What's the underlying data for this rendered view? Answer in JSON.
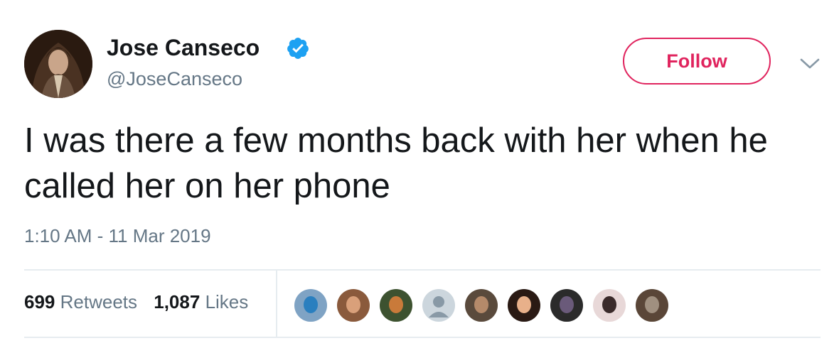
{
  "author": {
    "name": "Jose Canseco",
    "handle": "@JoseCanseco",
    "verified": true
  },
  "follow_button": {
    "label": "Follow"
  },
  "tweet": {
    "text": "I was there a few months back with her when he called her on her phone",
    "timestamp": "1:10 AM - 11 Mar 2019"
  },
  "stats": {
    "retweets_count": "699",
    "retweets_label": "Retweets",
    "likes_count": "1,087",
    "likes_label": "Likes"
  },
  "icons": {
    "verified": "verified-badge-icon",
    "menu": "chevron-down-icon"
  },
  "colors": {
    "accent": "#e0245e",
    "verified_blue": "#1da1f2",
    "secondary_text": "#657786",
    "primary_text": "#14171a",
    "divider": "#e6ecf0"
  },
  "liker_avatars": [
    {
      "bg": "#7fa3c4",
      "fg": "#2a7fbf"
    },
    {
      "bg": "#8a5a3c",
      "fg": "#d9a07a"
    },
    {
      "bg": "#3d5230",
      "fg": "#c97a3a"
    },
    {
      "bg": "#ccd6dd",
      "fg": "#8899a6"
    },
    {
      "bg": "#5a4a3c",
      "fg": "#b58a6a"
    },
    {
      "bg": "#2a1a14",
      "fg": "#e8b08a"
    },
    {
      "bg": "#2b2b2b",
      "fg": "#6a5a7a"
    },
    {
      "bg": "#e8d8d8",
      "fg": "#3a2a2a"
    },
    {
      "bg": "#5a4638",
      "fg": "#a09080"
    }
  ]
}
